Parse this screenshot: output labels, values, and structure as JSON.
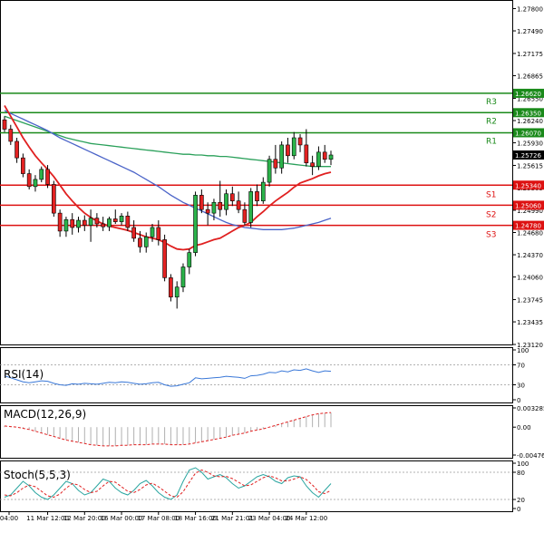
{
  "chart_data": {
    "type": "candlestick",
    "main": {
      "price_range": [
        1.2312,
        1.2792
      ],
      "y_ticks": [
        "1.27800",
        "1.27490",
        "1.27175",
        "1.26865",
        "1.26550",
        "1.26240",
        "1.25930",
        "1.25615",
        "1.25305",
        "1.24990",
        "1.24680",
        "1.24370",
        "1.24060",
        "1.23745",
        "1.23435",
        "1.23120"
      ],
      "x_ticks": [
        "04:00",
        "11 Mar 12:00",
        "12 Mar 20:00",
        "16 Mar 00:00",
        "17 Mar 08:00",
        "18 Mar 16:00",
        "21 Mar 21:01",
        "23 Mar 04:00",
        "24 Mar 12:00"
      ],
      "levels": [
        {
          "name": "R3",
          "value": 1.2662,
          "label": "1.26620",
          "color": "#1a8a1a"
        },
        {
          "name": "R2",
          "value": 1.2635,
          "label": "1.26350",
          "color": "#1a8a1a"
        },
        {
          "name": "R1",
          "value": 1.2607,
          "label": "1.26070",
          "color": "#1a8a1a"
        },
        {
          "name": "S1",
          "value": 1.2534,
          "label": "1.25340",
          "color": "#dd1111"
        },
        {
          "name": "S2",
          "value": 1.2506,
          "label": "1.25060",
          "color": "#dd1111"
        },
        {
          "name": "S3",
          "value": 1.2478,
          "label": "1.24780",
          "color": "#dd1111"
        }
      ],
      "current_price": "1.25726",
      "candles": [
        [
          1.2625,
          1.263,
          1.2608,
          1.2612
        ],
        [
          1.2612,
          1.2618,
          1.259,
          1.2595
        ],
        [
          1.2595,
          1.26,
          1.2565,
          1.2572
        ],
        [
          1.2572,
          1.2578,
          1.2545,
          1.255
        ],
        [
          1.255,
          1.2556,
          1.2528,
          1.2532
        ],
        [
          1.2532,
          1.2548,
          1.2525,
          1.2542
        ],
        [
          1.2542,
          1.256,
          1.2538,
          1.2556
        ],
        [
          1.2556,
          1.2562,
          1.253,
          1.2535
        ],
        [
          1.2535,
          1.254,
          1.249,
          1.2495
        ],
        [
          1.2495,
          1.25,
          1.2462,
          1.247
        ],
        [
          1.247,
          1.249,
          1.2462,
          1.2486
        ],
        [
          1.2486,
          1.2495,
          1.2465,
          1.2475
        ],
        [
          1.2475,
          1.249,
          1.2468,
          1.2485
        ],
        [
          1.2485,
          1.2492,
          1.247,
          1.2478
        ],
        [
          1.2478,
          1.25,
          1.2455,
          1.2488
        ],
        [
          1.2488,
          1.2495,
          1.2475,
          1.248
        ],
        [
          1.248,
          1.249,
          1.247,
          1.2476
        ],
        [
          1.2476,
          1.249,
          1.247,
          1.2487
        ],
        [
          1.2487,
          1.25,
          1.248,
          1.2483
        ],
        [
          1.2483,
          1.2495,
          1.2478,
          1.2491
        ],
        [
          1.2491,
          1.2497,
          1.247,
          1.2475
        ],
        [
          1.2475,
          1.2485,
          1.2455,
          1.246
        ],
        [
          1.246,
          1.247,
          1.244,
          1.2448
        ],
        [
          1.2448,
          1.2468,
          1.244,
          1.2462
        ],
        [
          1.2462,
          1.248,
          1.2455,
          1.2475
        ],
        [
          1.2475,
          1.2485,
          1.245,
          1.2458
        ],
        [
          1.2458,
          1.2465,
          1.24,
          1.2405
        ],
        [
          1.2405,
          1.241,
          1.2372,
          1.2378
        ],
        [
          1.2378,
          1.24,
          1.2362,
          1.2392
        ],
        [
          1.2392,
          1.2425,
          1.2385,
          1.242
        ],
        [
          1.242,
          1.2445,
          1.241,
          1.244
        ],
        [
          1.244,
          1.2525,
          1.2435,
          1.252
        ],
        [
          1.252,
          1.2528,
          1.2495,
          1.25
        ],
        [
          1.25,
          1.251,
          1.2478,
          1.2495
        ],
        [
          1.2495,
          1.2515,
          1.2485,
          1.251
        ],
        [
          1.251,
          1.254,
          1.249,
          1.25
        ],
        [
          1.25,
          1.2528,
          1.2492,
          1.2522
        ],
        [
          1.2522,
          1.2532,
          1.2505,
          1.2512
        ],
        [
          1.2512,
          1.2525,
          1.2495,
          1.25
        ],
        [
          1.25,
          1.251,
          1.2478,
          1.2482
        ],
        [
          1.2482,
          1.253,
          1.2475,
          1.2525
        ],
        [
          1.2525,
          1.2535,
          1.2505,
          1.2512
        ],
        [
          1.2512,
          1.2545,
          1.2508,
          1.2538
        ],
        [
          1.2538,
          1.2575,
          1.2532,
          1.257
        ],
        [
          1.257,
          1.259,
          1.255,
          1.2558
        ],
        [
          1.2558,
          1.2595,
          1.255,
          1.259
        ],
        [
          1.259,
          1.26,
          1.2565,
          1.2575
        ],
        [
          1.2575,
          1.2608,
          1.257,
          1.26
        ],
        [
          1.26,
          1.2605,
          1.258,
          1.259
        ],
        [
          1.259,
          1.2612,
          1.256,
          1.2565
        ],
        [
          1.2565,
          1.2575,
          1.2548,
          1.256
        ],
        [
          1.256,
          1.2588,
          1.2555,
          1.258
        ],
        [
          1.258,
          1.259,
          1.2565,
          1.257
        ],
        [
          1.257,
          1.2582,
          1.2562,
          1.2576
        ]
      ],
      "ma_red": [
        1.2645,
        1.263,
        1.2615,
        1.26,
        1.2587,
        1.2575,
        1.2565,
        1.2556,
        1.2546,
        1.2534,
        1.2522,
        1.2512,
        1.2503,
        1.2495,
        1.2489,
        1.2484,
        1.248,
        1.2477,
        1.2475,
        1.2473,
        1.2471,
        1.2468,
        1.2465,
        1.2462,
        1.246,
        1.2458,
        1.2454,
        1.2449,
        1.2445,
        1.2444,
        1.2445,
        1.245,
        1.2452,
        1.2455,
        1.2458,
        1.246,
        1.2465,
        1.247,
        1.2475,
        1.2478,
        1.2482,
        1.249,
        1.2497,
        1.2505,
        1.2512,
        1.2518,
        1.2524,
        1.2531,
        1.2537,
        1.254,
        1.2543,
        1.2547,
        1.255,
        1.2552
      ],
      "ma_blue": [
        1.2638,
        1.2634,
        1.263,
        1.2626,
        1.2622,
        1.2618,
        1.2614,
        1.261,
        1.2605,
        1.26,
        1.2596,
        1.2592,
        1.2588,
        1.2584,
        1.258,
        1.2576,
        1.2572,
        1.2568,
        1.2564,
        1.256,
        1.2556,
        1.2552,
        1.2547,
        1.2542,
        1.2537,
        1.2532,
        1.2526,
        1.252,
        1.2515,
        1.251,
        1.2506,
        1.2502,
        1.2498,
        1.2494,
        1.249,
        1.2486,
        1.2482,
        1.2479,
        1.2477,
        1.2475,
        1.2474,
        1.2473,
        1.2472,
        1.2472,
        1.2472,
        1.2472,
        1.2473,
        1.2474,
        1.2476,
        1.2478,
        1.248,
        1.2482,
        1.2485,
        1.2488
      ],
      "ma_green": [
        1.263,
        1.2627,
        1.2624,
        1.2621,
        1.2618,
        1.2615,
        1.2612,
        1.2609,
        1.2606,
        1.2603,
        1.26,
        1.2598,
        1.2596,
        1.2594,
        1.2592,
        1.2591,
        1.259,
        1.2589,
        1.2588,
        1.2587,
        1.2586,
        1.2585,
        1.2584,
        1.2583,
        1.2582,
        1.2581,
        1.258,
        1.2579,
        1.2578,
        1.2577,
        1.2577,
        1.2576,
        1.2576,
        1.2575,
        1.2575,
        1.2574,
        1.2574,
        1.2573,
        1.2572,
        1.2571,
        1.257,
        1.2569,
        1.2568,
        1.2567,
        1.2566,
        1.2565,
        1.2564,
        1.2563,
        1.2562,
        1.2561,
        1.256,
        1.256,
        1.256,
        1.256
      ]
    },
    "rsi": {
      "label": "RSI(14)",
      "range": [
        0,
        100
      ],
      "ticks": [
        "100",
        "70",
        "30",
        "0"
      ],
      "values": [
        48,
        44,
        40,
        36,
        34,
        36,
        38,
        37,
        33,
        30,
        29,
        32,
        31,
        33,
        32,
        31,
        33,
        35,
        34,
        36,
        35,
        33,
        31,
        32,
        34,
        35,
        30,
        27,
        28,
        31,
        34,
        44,
        42,
        43,
        44,
        45,
        47,
        46,
        45,
        43,
        48,
        49,
        51,
        55,
        54,
        58,
        56,
        60,
        59,
        62,
        58,
        55,
        58,
        57
      ]
    },
    "macd": {
      "label": "MACD(12,26,9)",
      "range": [
        -0.004769,
        0.003285
      ],
      "ticks": [
        "0.003285",
        "0.00",
        "-0.004769"
      ],
      "histogram_visible": true,
      "signal": [
        0.0002,
        0.0001,
        0.0,
        -0.0002,
        -0.0004,
        -0.0007,
        -0.001,
        -0.0013,
        -0.0016,
        -0.0019,
        -0.0022,
        -0.0024,
        -0.0026,
        -0.0028,
        -0.003,
        -0.0031,
        -0.0032,
        -0.0032,
        -0.0032,
        -0.0031,
        -0.0031,
        -0.003,
        -0.003,
        -0.003,
        -0.0029,
        -0.0029,
        -0.0029,
        -0.003,
        -0.003,
        -0.003,
        -0.0029,
        -0.0027,
        -0.0025,
        -0.0023,
        -0.0021,
        -0.0019,
        -0.0017,
        -0.0014,
        -0.0012,
        -0.001,
        -0.0007,
        -0.0005,
        -0.0003,
        0.0,
        0.0003,
        0.0006,
        0.0009,
        0.0012,
        0.0015,
        0.0018,
        0.0021,
        0.0023,
        0.0024,
        0.0025
      ]
    },
    "stoch": {
      "label": "Stoch(5,5,3)",
      "range": [
        0,
        100
      ],
      "ticks": [
        "100",
        "80",
        "20",
        "0"
      ],
      "main": [
        25,
        30,
        45,
        60,
        50,
        35,
        25,
        20,
        30,
        45,
        60,
        55,
        40,
        30,
        35,
        50,
        65,
        60,
        45,
        35,
        30,
        40,
        55,
        62,
        50,
        35,
        25,
        20,
        30,
        60,
        85,
        90,
        80,
        65,
        70,
        75,
        68,
        55,
        45,
        50,
        60,
        70,
        75,
        70,
        60,
        55,
        68,
        72,
        70,
        50,
        35,
        25,
        40,
        55
      ],
      "signal": [
        30,
        28,
        35,
        45,
        52,
        48,
        38,
        28,
        25,
        32,
        45,
        55,
        52,
        42,
        35,
        38,
        50,
        60,
        58,
        48,
        38,
        35,
        42,
        52,
        56,
        48,
        38,
        28,
        25,
        37,
        58,
        78,
        85,
        80,
        72,
        70,
        71,
        66,
        58,
        50,
        52,
        60,
        68,
        72,
        68,
        61,
        61,
        65,
        70,
        64,
        52,
        37,
        33,
        40
      ]
    }
  }
}
